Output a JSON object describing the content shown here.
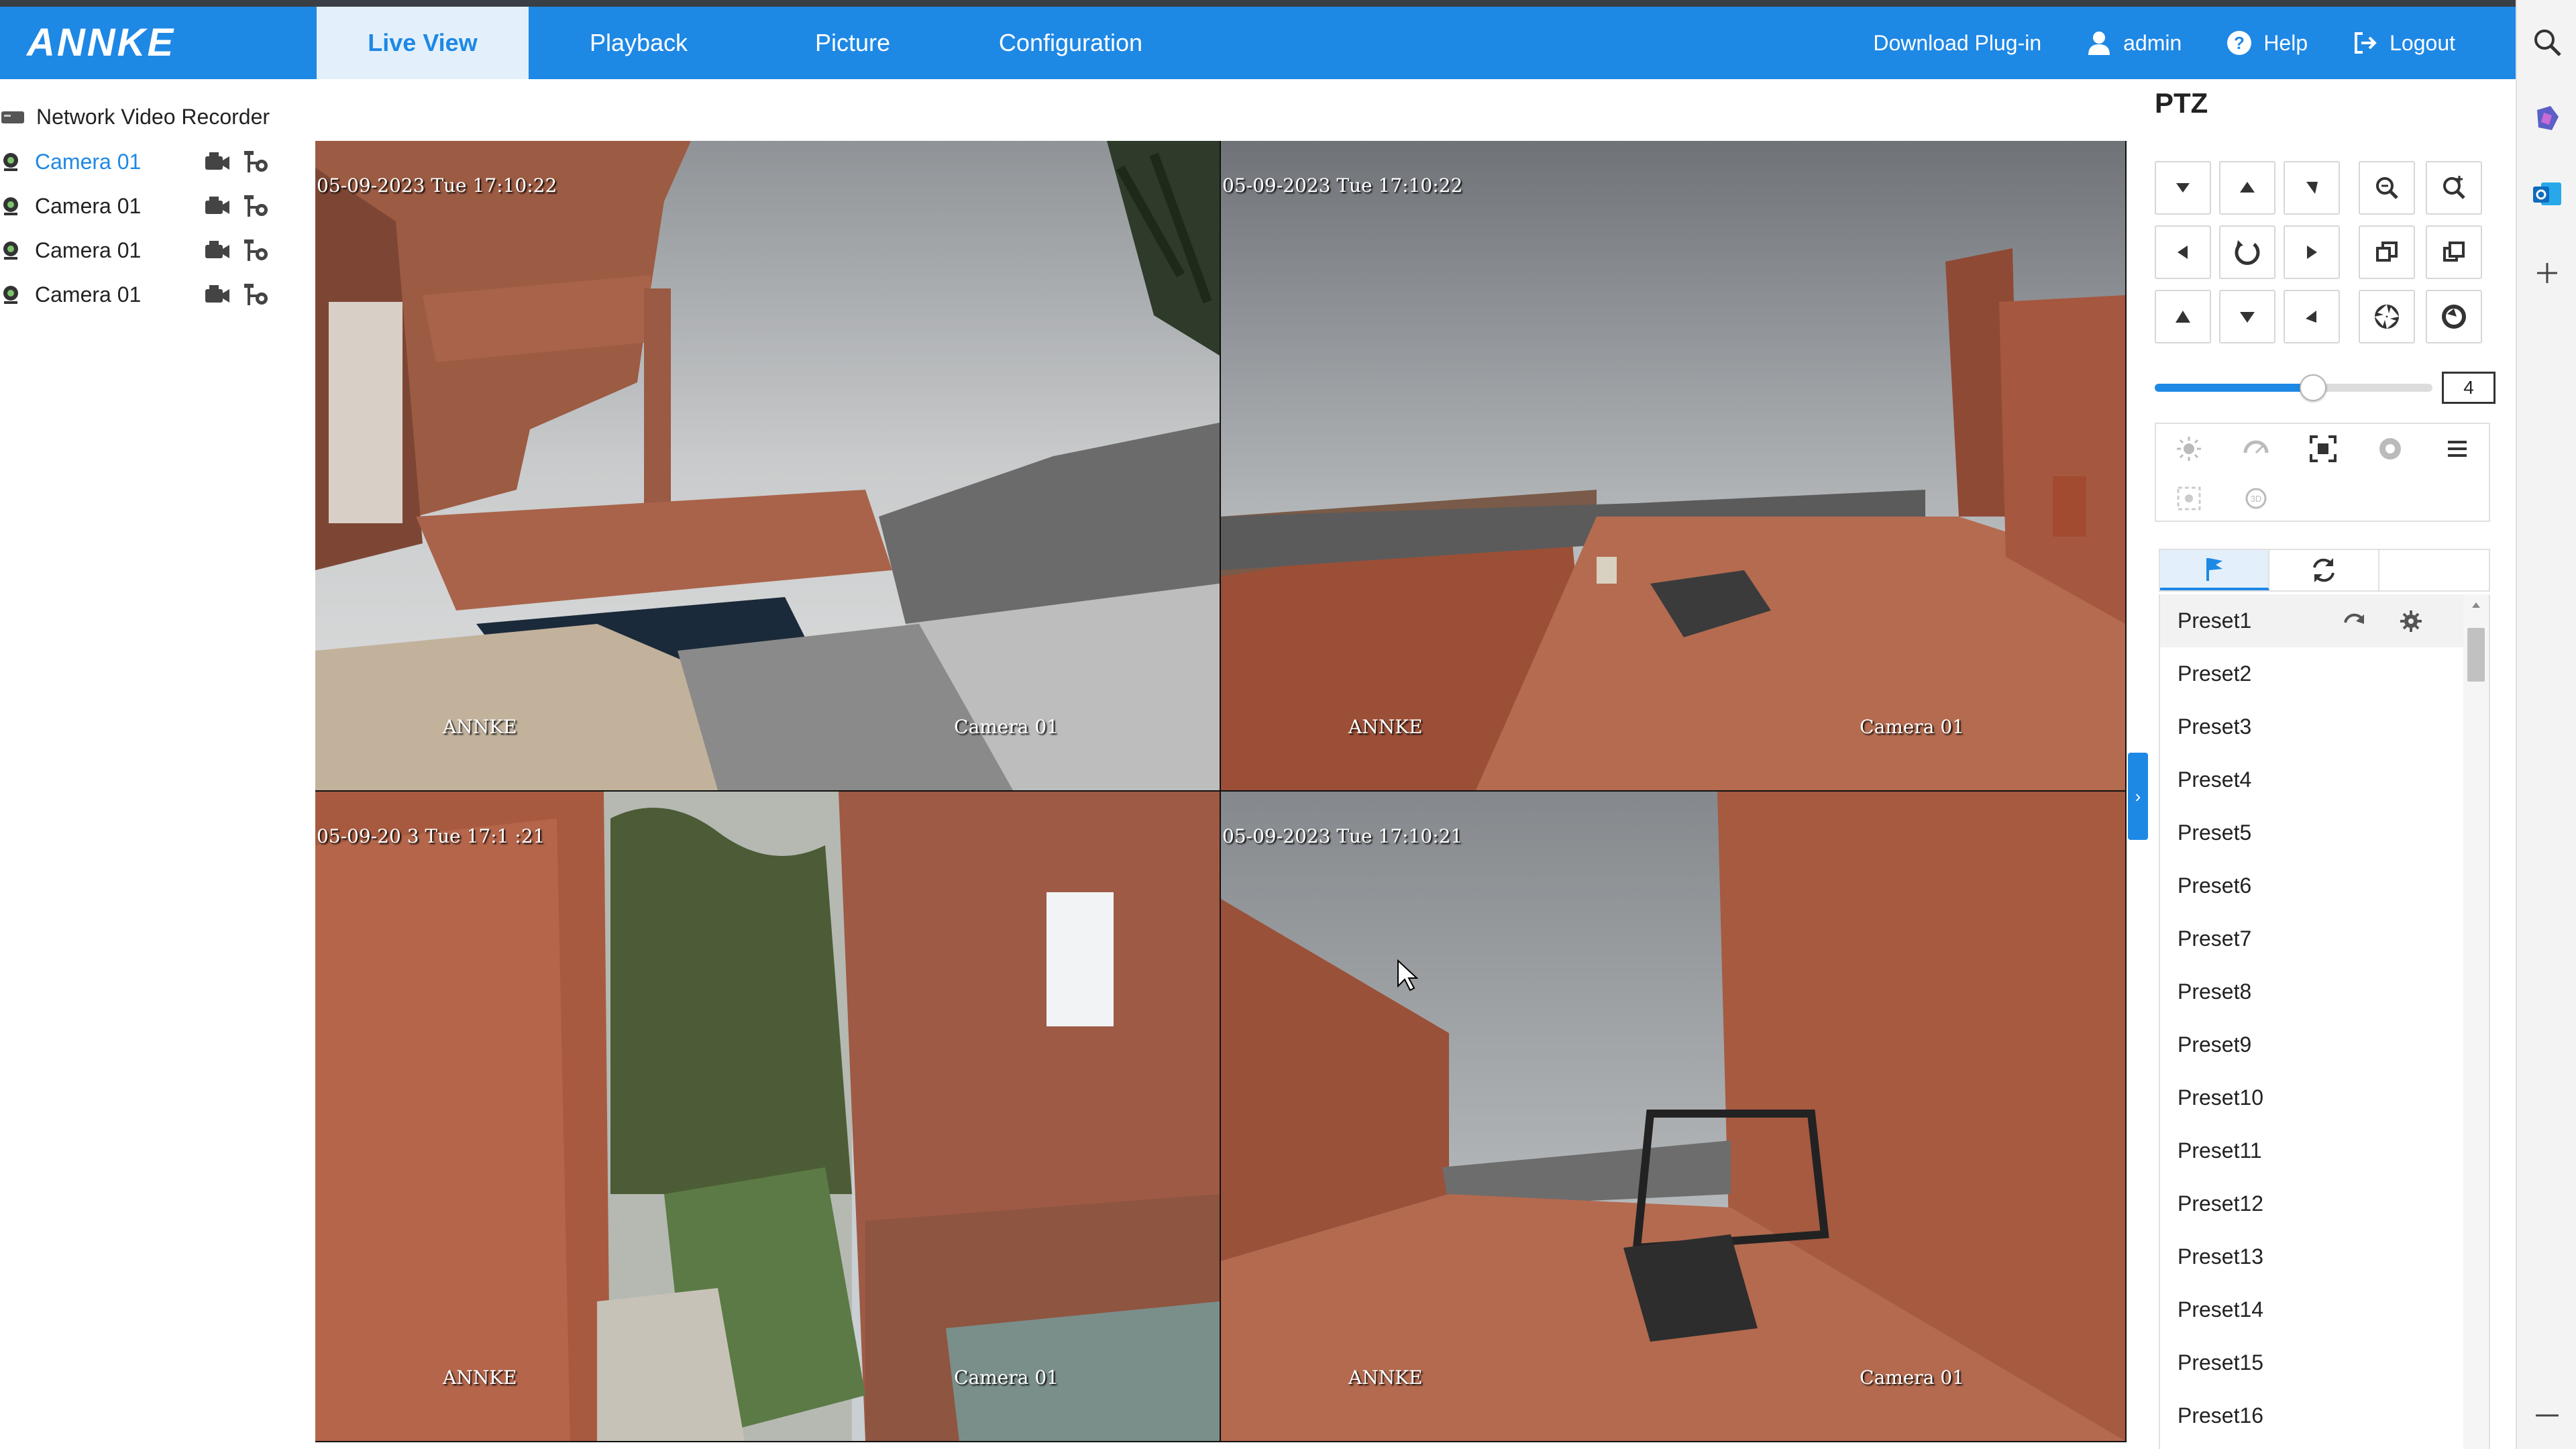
{
  "header": {
    "logo": "ANNKE",
    "tabs": [
      "Live View",
      "Playback",
      "Picture",
      "Configuration"
    ],
    "active_tab": "Live View",
    "download_plugin": "Download Plug-in",
    "user": "admin",
    "help": "Help",
    "logout": "Logout",
    "accent_color": "#1e88e5"
  },
  "tree": {
    "root": "Network Video Recorder",
    "cameras": [
      {
        "label": "Camera 01",
        "selected": true
      },
      {
        "label": "Camera 01",
        "selected": false
      },
      {
        "label": "Camera 01",
        "selected": false
      },
      {
        "label": "Camera 01",
        "selected": false
      }
    ]
  },
  "views": [
    {
      "timestamp": "05-09-2023 Tue 17:10:22",
      "brand": "ANNKE",
      "camera": "Camera 01"
    },
    {
      "timestamp": "05-09-2023 Tue 17:10:22",
      "brand": "ANNKE",
      "camera": "Camera 01"
    },
    {
      "timestamp": "05-09-20 3 Tue 17:1 :21",
      "brand": "ANNKE",
      "camera": "Camera 01"
    },
    {
      "timestamp": "05-09-2023 Tue 17:10:21",
      "brand": "ANNKE",
      "camera": "Camera 01"
    }
  ],
  "ptz": {
    "title": "PTZ",
    "speed": "4",
    "speed_fraction": 0.57,
    "presets": [
      "Preset1",
      "Preset2",
      "Preset3",
      "Preset4",
      "Preset5",
      "Preset6",
      "Preset7",
      "Preset8",
      "Preset9",
      "Preset10",
      "Preset11",
      "Preset12",
      "Preset13",
      "Preset14",
      "Preset15",
      "Preset16"
    ]
  }
}
